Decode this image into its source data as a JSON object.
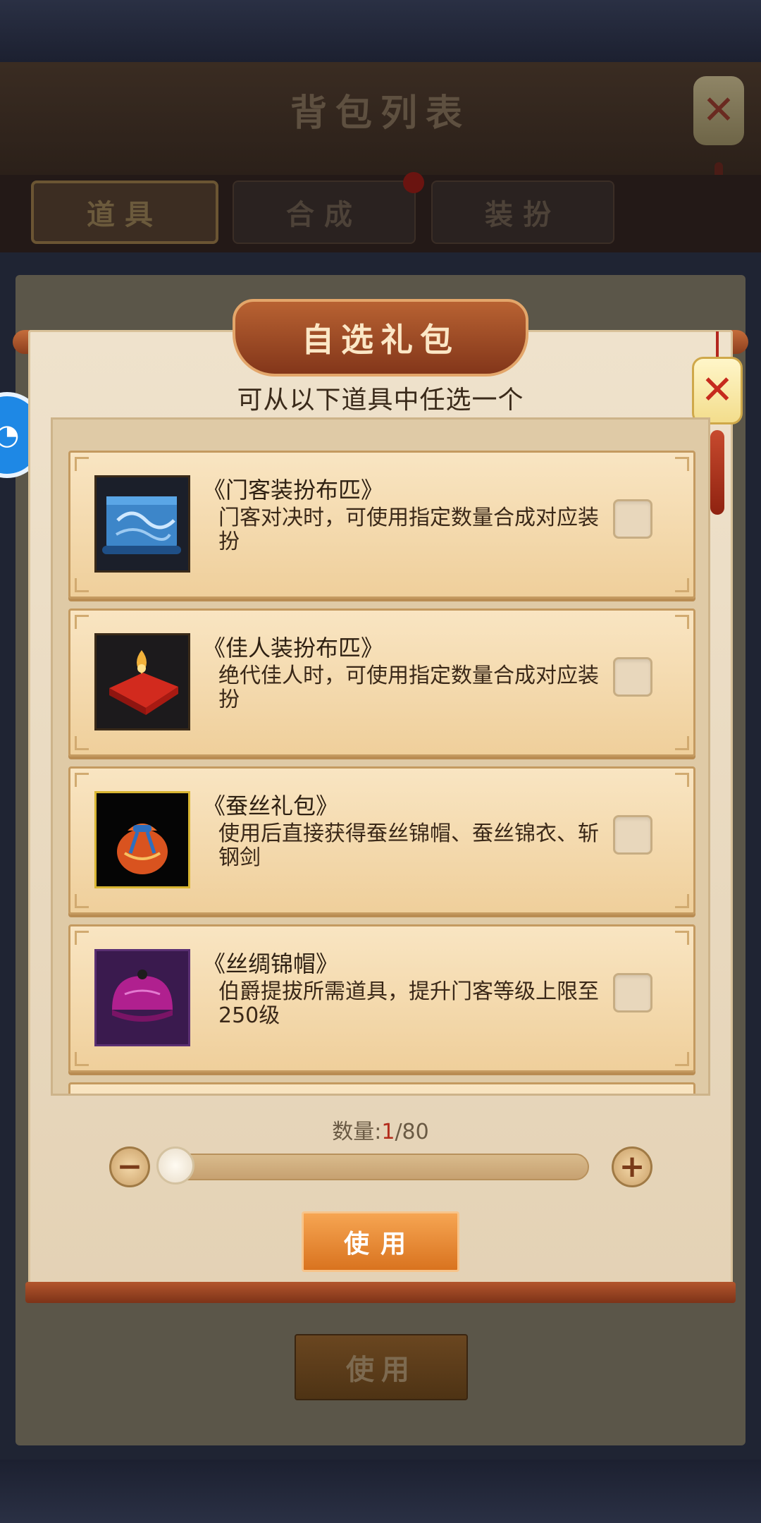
{
  "backpack": {
    "title": "背包列表",
    "tabs": [
      {
        "label": "道具",
        "active": true
      },
      {
        "label": "合成",
        "active": false,
        "has_red_dot": true
      },
      {
        "label": "装扮",
        "active": false
      }
    ],
    "use_label": "使用",
    "close_icon": "close-icon"
  },
  "side_badge": {
    "icon": "assistant-icon"
  },
  "dialog": {
    "title": "自选礼包",
    "subtitle": "可从以下道具中任选一个",
    "close_icon": "close-icon",
    "items": [
      {
        "name": "《门客装扮布匹》",
        "desc": "门客对决时，可使用指定数量合成对应装扮",
        "icon": "blue-scroll-icon",
        "checked": false
      },
      {
        "name": "《佳人装扮布匹》",
        "desc": "绝代佳人时，可使用指定数量合成对应装扮",
        "icon": "red-cloth-icon",
        "checked": false
      },
      {
        "name": "《蚕丝礼包》",
        "desc": "使用后直接获得蚕丝锦帽、蚕丝锦衣、斩钢剑",
        "icon": "gift-bag-icon",
        "checked": false
      },
      {
        "name": "《丝绸锦帽》",
        "desc": "伯爵提拔所需道具，提升门客等级上限至250级",
        "icon": "silk-hat-icon",
        "checked": false
      }
    ],
    "quantity": {
      "label": "数量:",
      "current": "1",
      "separator_max": "/80",
      "value": 1,
      "max": 80
    },
    "use_label": "使用",
    "colors": {
      "accent": "#e07a26",
      "title_plate": "#a4512a",
      "quantity_current": "#b32c1c"
    }
  }
}
